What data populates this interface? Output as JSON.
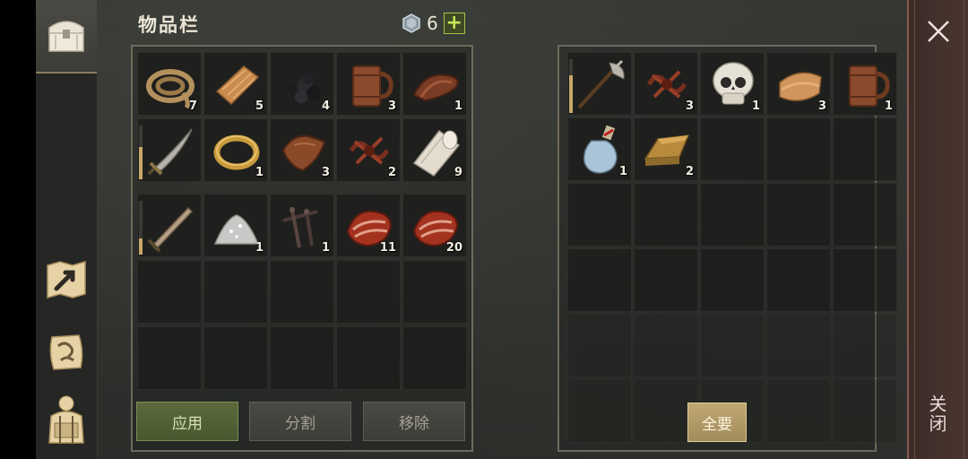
{
  "title": "物品栏",
  "currency": {
    "amount": "6",
    "plus": "+"
  },
  "inventory": {
    "rows": [
      [
        {
          "name": "rope",
          "qty": "7"
        },
        {
          "name": "cloth",
          "qty": "5"
        },
        {
          "name": "coal",
          "qty": "4"
        },
        {
          "name": "wooden-mug",
          "qty": "3"
        },
        {
          "name": "leather-strap",
          "qty": "1"
        }
      ],
      [
        {
          "name": "sabre",
          "qty": "",
          "durability": 0.6
        },
        {
          "name": "gold-ring",
          "qty": "1"
        },
        {
          "name": "leather",
          "qty": "3"
        },
        {
          "name": "leather-cords",
          "qty": "2"
        },
        {
          "name": "linen-roll",
          "qty": "9"
        }
      ],
      [
        {
          "name": "long-sword",
          "qty": "",
          "durability": 0.3
        },
        {
          "name": "salt-pile",
          "qty": "1"
        },
        {
          "name": "iron-nails",
          "qty": "1"
        },
        {
          "name": "raw-meat",
          "qty": "11"
        },
        {
          "name": "raw-meat",
          "qty": "20"
        }
      ]
    ]
  },
  "loot": {
    "rows": [
      [
        {
          "name": "halberd",
          "qty": "",
          "durability": 0.7
        },
        {
          "name": "leather-cords",
          "qty": "3"
        },
        {
          "name": "skull",
          "qty": "1"
        },
        {
          "name": "folded-cloth",
          "qty": "3"
        },
        {
          "name": "wooden-mug",
          "qty": "1"
        }
      ],
      [
        {
          "name": "potion-flask",
          "qty": "1"
        },
        {
          "name": "gold-ingot",
          "qty": "2"
        }
      ]
    ]
  },
  "buttons": {
    "apply": "应用",
    "split": "分割",
    "remove": "移除",
    "take_all": "全要"
  },
  "close": {
    "label": "关闭"
  }
}
